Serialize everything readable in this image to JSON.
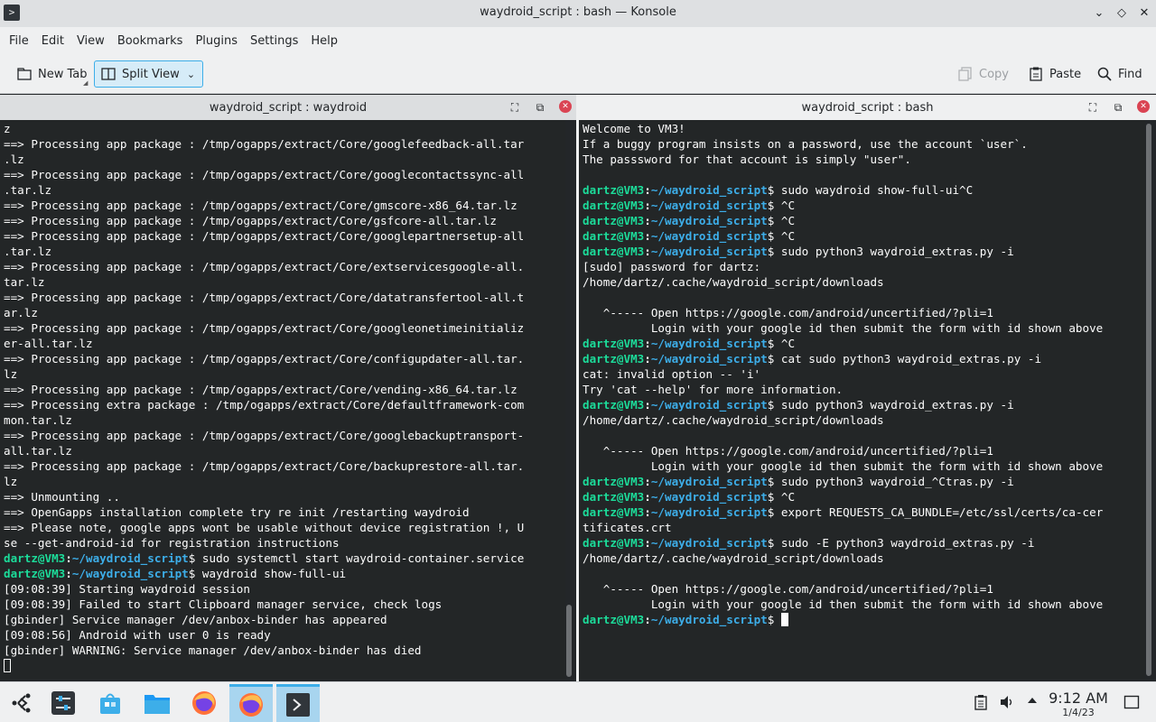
{
  "window": {
    "title": "waydroid_script : bash — Konsole",
    "app_icon_glyph": ">",
    "controls": {
      "minimize": "⌄",
      "maximize": "◇",
      "close": "✕"
    }
  },
  "menubar": [
    "File",
    "Edit",
    "View",
    "Bookmarks",
    "Plugins",
    "Settings",
    "Help"
  ],
  "toolbar": {
    "new_tab": "New Tab",
    "split_view": "Split View",
    "copy": "Copy",
    "paste": "Paste",
    "find": "Find"
  },
  "left_pane": {
    "title": "waydroid_script : waydroid",
    "lines": [
      [
        {
          "t": "z"
        }
      ],
      [
        {
          "t": "==> Processing app package : /tmp/ogapps/extract/Core/googlefeedback-all.tar"
        }
      ],
      [
        {
          "t": ".lz"
        }
      ],
      [
        {
          "t": "==> Processing app package : /tmp/ogapps/extract/Core/googlecontactssync-all"
        }
      ],
      [
        {
          "t": ".tar.lz"
        }
      ],
      [
        {
          "t": "==> Processing app package : /tmp/ogapps/extract/Core/gmscore-x86_64.tar.lz"
        }
      ],
      [
        {
          "t": "==> Processing app package : /tmp/ogapps/extract/Core/gsfcore-all.tar.lz"
        }
      ],
      [
        {
          "t": "==> Processing app package : /tmp/ogapps/extract/Core/googlepartnersetup-all"
        }
      ],
      [
        {
          "t": ".tar.lz"
        }
      ],
      [
        {
          "t": "==> Processing app package : /tmp/ogapps/extract/Core/extservicesgoogle-all."
        }
      ],
      [
        {
          "t": "tar.lz"
        }
      ],
      [
        {
          "t": "==> Processing app package : /tmp/ogapps/extract/Core/datatransfertool-all.t"
        }
      ],
      [
        {
          "t": "ar.lz"
        }
      ],
      [
        {
          "t": "==> Processing app package : /tmp/ogapps/extract/Core/googleonetimeinitializ"
        }
      ],
      [
        {
          "t": "er-all.tar.lz"
        }
      ],
      [
        {
          "t": "==> Processing app package : /tmp/ogapps/extract/Core/configupdater-all.tar."
        }
      ],
      [
        {
          "t": "lz"
        }
      ],
      [
        {
          "t": "==> Processing app package : /tmp/ogapps/extract/Core/vending-x86_64.tar.lz"
        }
      ],
      [
        {
          "t": "==> Processing extra package : /tmp/ogapps/extract/Core/defaultframework-com"
        }
      ],
      [
        {
          "t": "mon.tar.lz"
        }
      ],
      [
        {
          "t": "==> Processing app package : /tmp/ogapps/extract/Core/googlebackuptransport-"
        }
      ],
      [
        {
          "t": "all.tar.lz"
        }
      ],
      [
        {
          "t": "==> Processing app package : /tmp/ogapps/extract/Core/backuprestore-all.tar."
        }
      ],
      [
        {
          "t": "lz"
        }
      ],
      [
        {
          "t": "==> Unmounting .."
        }
      ],
      [
        {
          "t": "==> OpenGapps installation complete try re init /restarting waydroid"
        }
      ],
      [
        {
          "t": "==> Please note, google apps wont be usable without device registration !, U"
        }
      ],
      [
        {
          "t": "se --get-android-id for registration instructions"
        }
      ],
      [
        {
          "t": "dartz@VM3",
          "c": "p-user"
        },
        {
          "t": ":",
          "c": "p-sep"
        },
        {
          "t": "~/waydroid_script",
          "c": "p-path"
        },
        {
          "t": "$ sudo systemctl start waydroid-container.service"
        }
      ],
      [
        {
          "t": "dartz@VM3",
          "c": "p-user"
        },
        {
          "t": ":",
          "c": "p-sep"
        },
        {
          "t": "~/waydroid_script",
          "c": "p-path"
        },
        {
          "t": "$ waydroid show-full-ui"
        }
      ],
      [
        {
          "t": "[09:08:39] Starting waydroid session"
        }
      ],
      [
        {
          "t": "[09:08:39] Failed to start Clipboard manager service, check logs"
        }
      ],
      [
        {
          "t": "[gbinder] Service manager /dev/anbox-binder has appeared"
        }
      ],
      [
        {
          "t": "[09:08:56] Android with user 0 is ready"
        }
      ],
      [
        {
          "t": "[gbinder] WARNING: Service manager /dev/anbox-binder has died"
        }
      ]
    ]
  },
  "right_pane": {
    "title": "waydroid_script : bash",
    "lines": [
      [
        {
          "t": "Welcome to VM3!"
        }
      ],
      [
        {
          "t": "If a buggy program insists on a password, use the account `user`."
        }
      ],
      [
        {
          "t": "The passsword for that account is simply \"user\"."
        }
      ],
      [
        {
          "t": ""
        }
      ],
      [
        {
          "t": "dartz@VM3",
          "c": "p-user"
        },
        {
          "t": ":",
          "c": "p-sep"
        },
        {
          "t": "~/waydroid_script",
          "c": "p-path"
        },
        {
          "t": "$ sudo waydroid show-full-ui^C"
        }
      ],
      [
        {
          "t": "dartz@VM3",
          "c": "p-user"
        },
        {
          "t": ":",
          "c": "p-sep"
        },
        {
          "t": "~/waydroid_script",
          "c": "p-path"
        },
        {
          "t": "$ ^C"
        }
      ],
      [
        {
          "t": "dartz@VM3",
          "c": "p-user"
        },
        {
          "t": ":",
          "c": "p-sep"
        },
        {
          "t": "~/waydroid_script",
          "c": "p-path"
        },
        {
          "t": "$ ^C"
        }
      ],
      [
        {
          "t": "dartz@VM3",
          "c": "p-user"
        },
        {
          "t": ":",
          "c": "p-sep"
        },
        {
          "t": "~/waydroid_script",
          "c": "p-path"
        },
        {
          "t": "$ ^C"
        }
      ],
      [
        {
          "t": "dartz@VM3",
          "c": "p-user"
        },
        {
          "t": ":",
          "c": "p-sep"
        },
        {
          "t": "~/waydroid_script",
          "c": "p-path"
        },
        {
          "t": "$ sudo python3 waydroid_extras.py -i"
        }
      ],
      [
        {
          "t": "[sudo] password for dartz:"
        }
      ],
      [
        {
          "t": "/home/dartz/.cache/waydroid_script/downloads"
        }
      ],
      [
        {
          "t": ""
        }
      ],
      [
        {
          "t": "   ^----- Open https://google.com/android/uncertified/?pli=1"
        }
      ],
      [
        {
          "t": "          Login with your google id then submit the form with id shown above"
        }
      ],
      [
        {
          "t": "dartz@VM3",
          "c": "p-user"
        },
        {
          "t": ":",
          "c": "p-sep"
        },
        {
          "t": "~/waydroid_script",
          "c": "p-path"
        },
        {
          "t": "$ ^C"
        }
      ],
      [
        {
          "t": "dartz@VM3",
          "c": "p-user"
        },
        {
          "t": ":",
          "c": "p-sep"
        },
        {
          "t": "~/waydroid_script",
          "c": "p-path"
        },
        {
          "t": "$ cat sudo python3 waydroid_extras.py -i"
        }
      ],
      [
        {
          "t": "cat: invalid option -- 'i'"
        }
      ],
      [
        {
          "t": "Try 'cat --help' for more information."
        }
      ],
      [
        {
          "t": "dartz@VM3",
          "c": "p-user"
        },
        {
          "t": ":",
          "c": "p-sep"
        },
        {
          "t": "~/waydroid_script",
          "c": "p-path"
        },
        {
          "t": "$ sudo python3 waydroid_extras.py -i"
        }
      ],
      [
        {
          "t": "/home/dartz/.cache/waydroid_script/downloads"
        }
      ],
      [
        {
          "t": ""
        }
      ],
      [
        {
          "t": "   ^----- Open https://google.com/android/uncertified/?pli=1"
        }
      ],
      [
        {
          "t": "          Login with your google id then submit the form with id shown above"
        }
      ],
      [
        {
          "t": "dartz@VM3",
          "c": "p-user"
        },
        {
          "t": ":",
          "c": "p-sep"
        },
        {
          "t": "~/waydroid_script",
          "c": "p-path"
        },
        {
          "t": "$ sudo python3 waydroid_^Ctras.py -i"
        }
      ],
      [
        {
          "t": "dartz@VM3",
          "c": "p-user"
        },
        {
          "t": ":",
          "c": "p-sep"
        },
        {
          "t": "~/waydroid_script",
          "c": "p-path"
        },
        {
          "t": "$ ^C"
        }
      ],
      [
        {
          "t": "dartz@VM3",
          "c": "p-user"
        },
        {
          "t": ":",
          "c": "p-sep"
        },
        {
          "t": "~/waydroid_script",
          "c": "p-path"
        },
        {
          "t": "$ export REQUESTS_CA_BUNDLE=/etc/ssl/certs/ca-cer"
        }
      ],
      [
        {
          "t": "tificates.crt"
        }
      ],
      [
        {
          "t": "dartz@VM3",
          "c": "p-user"
        },
        {
          "t": ":",
          "c": "p-sep"
        },
        {
          "t": "~/waydroid_script",
          "c": "p-path"
        },
        {
          "t": "$ sudo -E python3 waydroid_extras.py -i"
        }
      ],
      [
        {
          "t": "/home/dartz/.cache/waydroid_script/downloads"
        }
      ],
      [
        {
          "t": ""
        }
      ],
      [
        {
          "t": "   ^----- Open https://google.com/android/uncertified/?pli=1"
        }
      ],
      [
        {
          "t": "          Login with your google id then submit the form with id shown above"
        }
      ],
      [
        {
          "t": "dartz@VM3",
          "c": "p-user"
        },
        {
          "t": ":",
          "c": "p-sep"
        },
        {
          "t": "~/waydroid_script",
          "c": "p-path"
        },
        {
          "t": "$ "
        }
      ]
    ]
  },
  "taskbar": {
    "clock_time": "9:12 AM",
    "clock_date": "1/4/23"
  },
  "colors": {
    "terminal_bg": "#232627",
    "prompt_user": "#1cdc9a",
    "prompt_path": "#3daee9",
    "accent": "#3daee9"
  }
}
